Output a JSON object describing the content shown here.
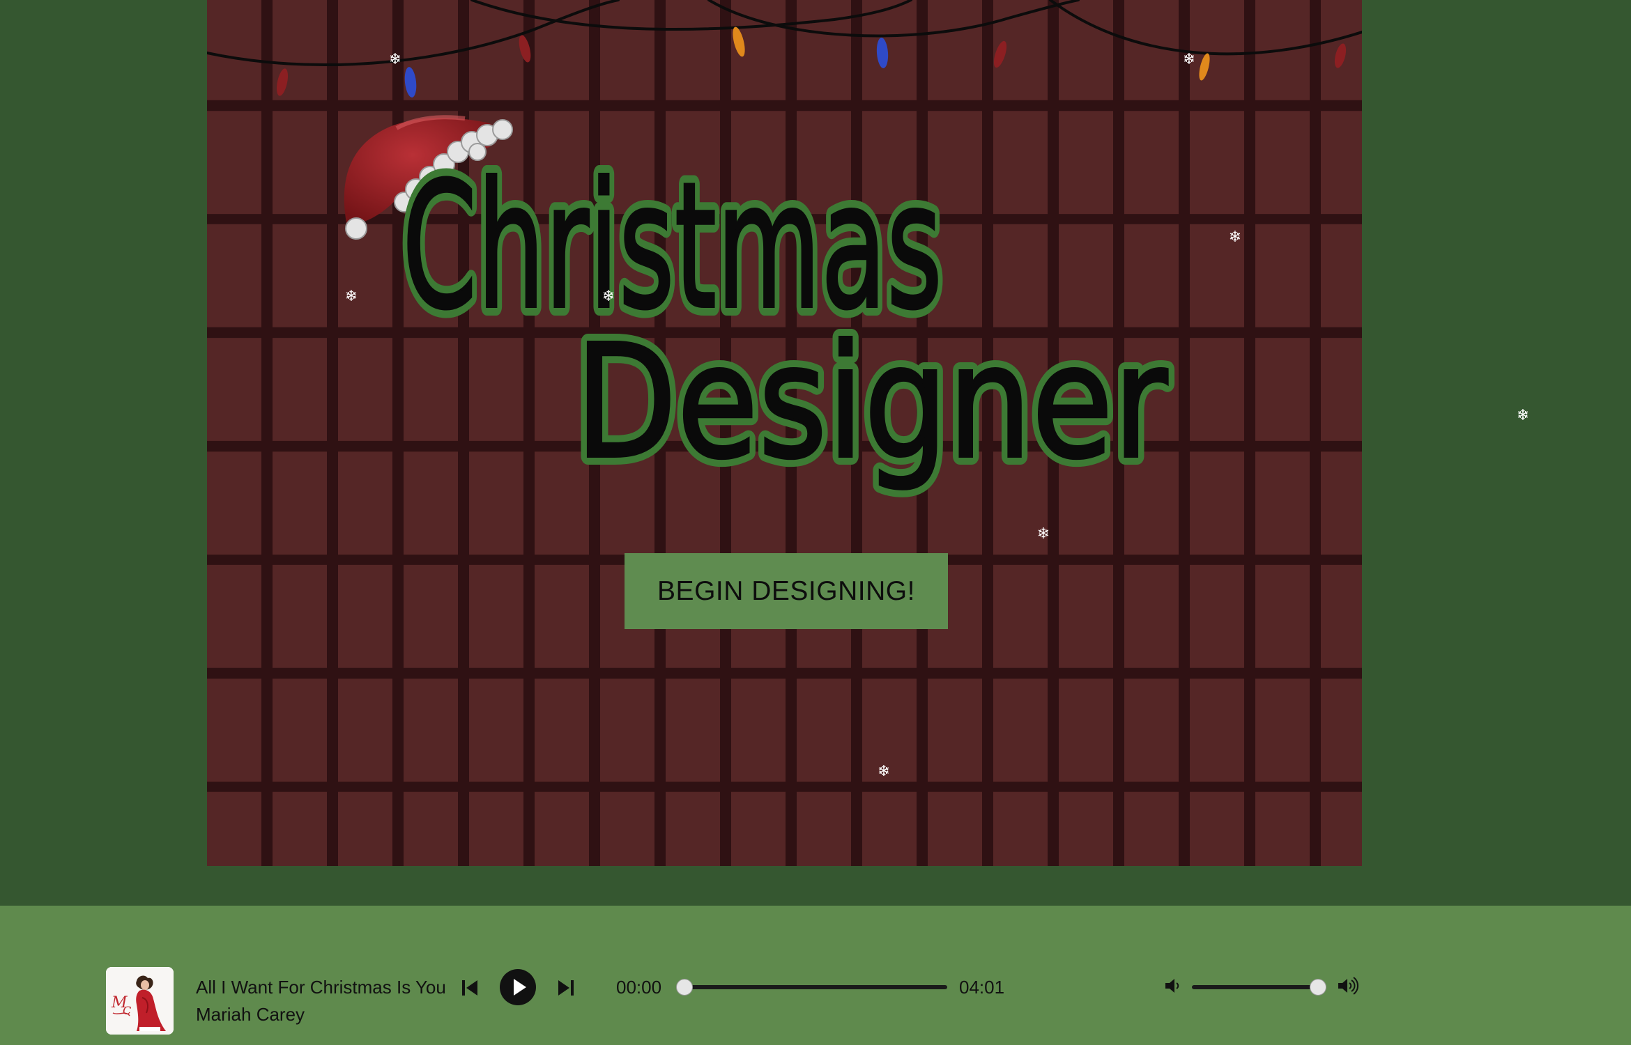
{
  "app": {
    "title": "Christmas Designer",
    "title_line1": "Christmas",
    "title_line2": "Designer",
    "begin_button_label": "BEGIN DESIGNING!"
  },
  "colors": {
    "page_background": "#355730",
    "canvas_background": "#552626",
    "canvas_grid_lines": "#2f1113",
    "button_background": "#5f8c50",
    "player_background": "#5f8a4d",
    "title_outline": "#3d7a34",
    "title_fill": "#0a0a0a",
    "light_colors": [
      "#8c1f22",
      "#2f4ac8",
      "#e0891c",
      "#b0242a"
    ]
  },
  "decorations": {
    "snowflake_glyph": "❄",
    "icons": [
      "santa-hat-icon",
      "string-lights-icon",
      "snowflake-icon"
    ]
  },
  "player": {
    "track_title": "All I Want For Christmas Is You",
    "artist": "Mariah Carey",
    "current_time": "00:00",
    "total_time": "04:01",
    "progress_fraction": 0.0,
    "volume_fraction": 1.0,
    "icons": {
      "previous": "skip-previous-icon",
      "play": "play-icon",
      "next": "skip-next-icon",
      "volume_low": "volume-low-icon",
      "volume_high": "volume-high-icon"
    }
  }
}
